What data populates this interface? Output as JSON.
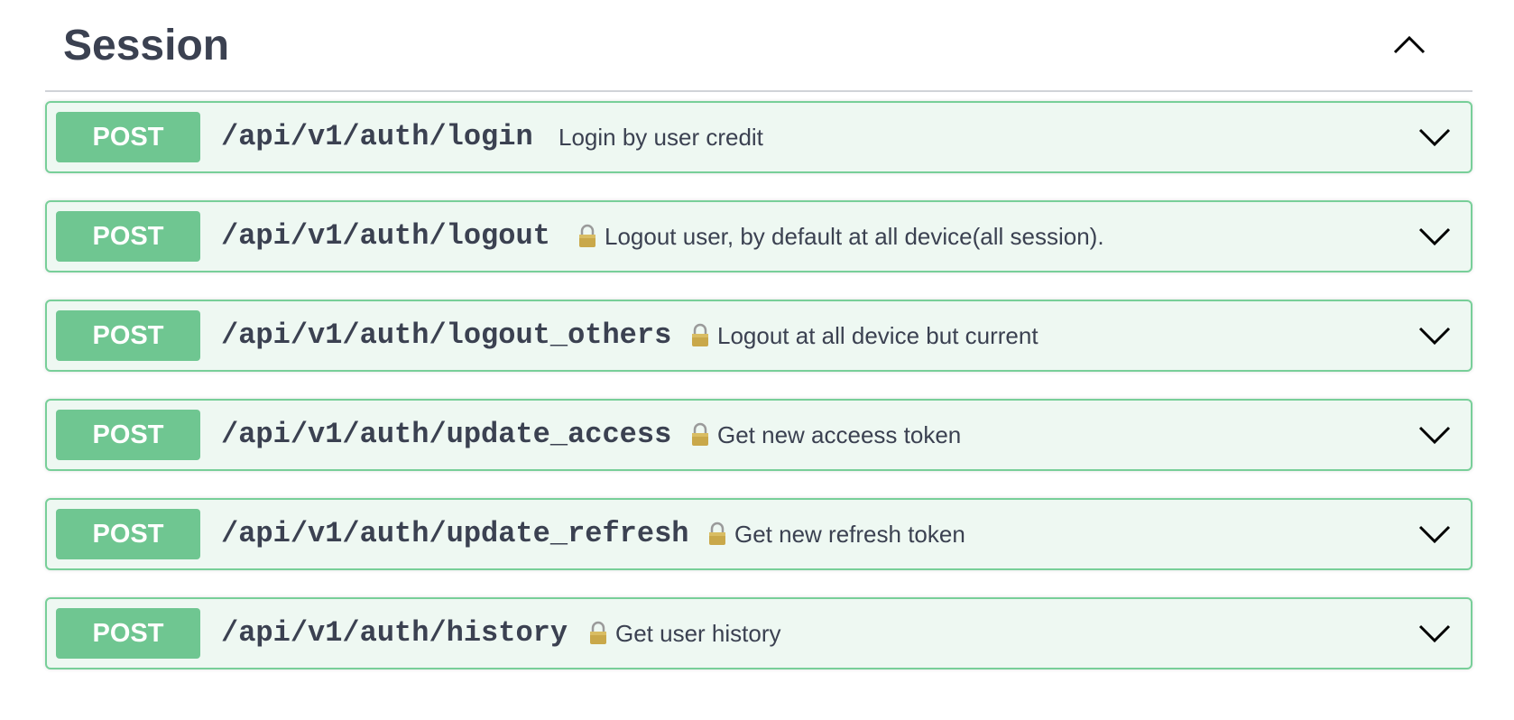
{
  "section": {
    "title": "Session"
  },
  "operations": [
    {
      "method": "POST",
      "path": "/api/v1/auth/login",
      "locked": false,
      "summary": "Login by user credit"
    },
    {
      "method": "POST",
      "path": "/api/v1/auth/logout",
      "locked": true,
      "summary": "Logout user, by default at all device(all session)."
    },
    {
      "method": "POST",
      "path": "/api/v1/auth/logout_others",
      "locked": true,
      "summary": "Logout at all device but current"
    },
    {
      "method": "POST",
      "path": "/api/v1/auth/update_access",
      "locked": true,
      "summary": "Get new acceess token"
    },
    {
      "method": "POST",
      "path": "/api/v1/auth/update_refresh",
      "locked": true,
      "summary": "Get new refresh token"
    },
    {
      "method": "POST",
      "path": "/api/v1/auth/history",
      "locked": true,
      "summary": "Get user history"
    }
  ],
  "colors": {
    "post_method_bg": "#6fc691",
    "post_border": "#78cf99",
    "post_bg": "#eef8f2",
    "text": "#3b4151"
  },
  "icons": {
    "lock": "lock-icon",
    "expand": "chevron-down-icon",
    "collapse": "chevron-up-icon"
  }
}
